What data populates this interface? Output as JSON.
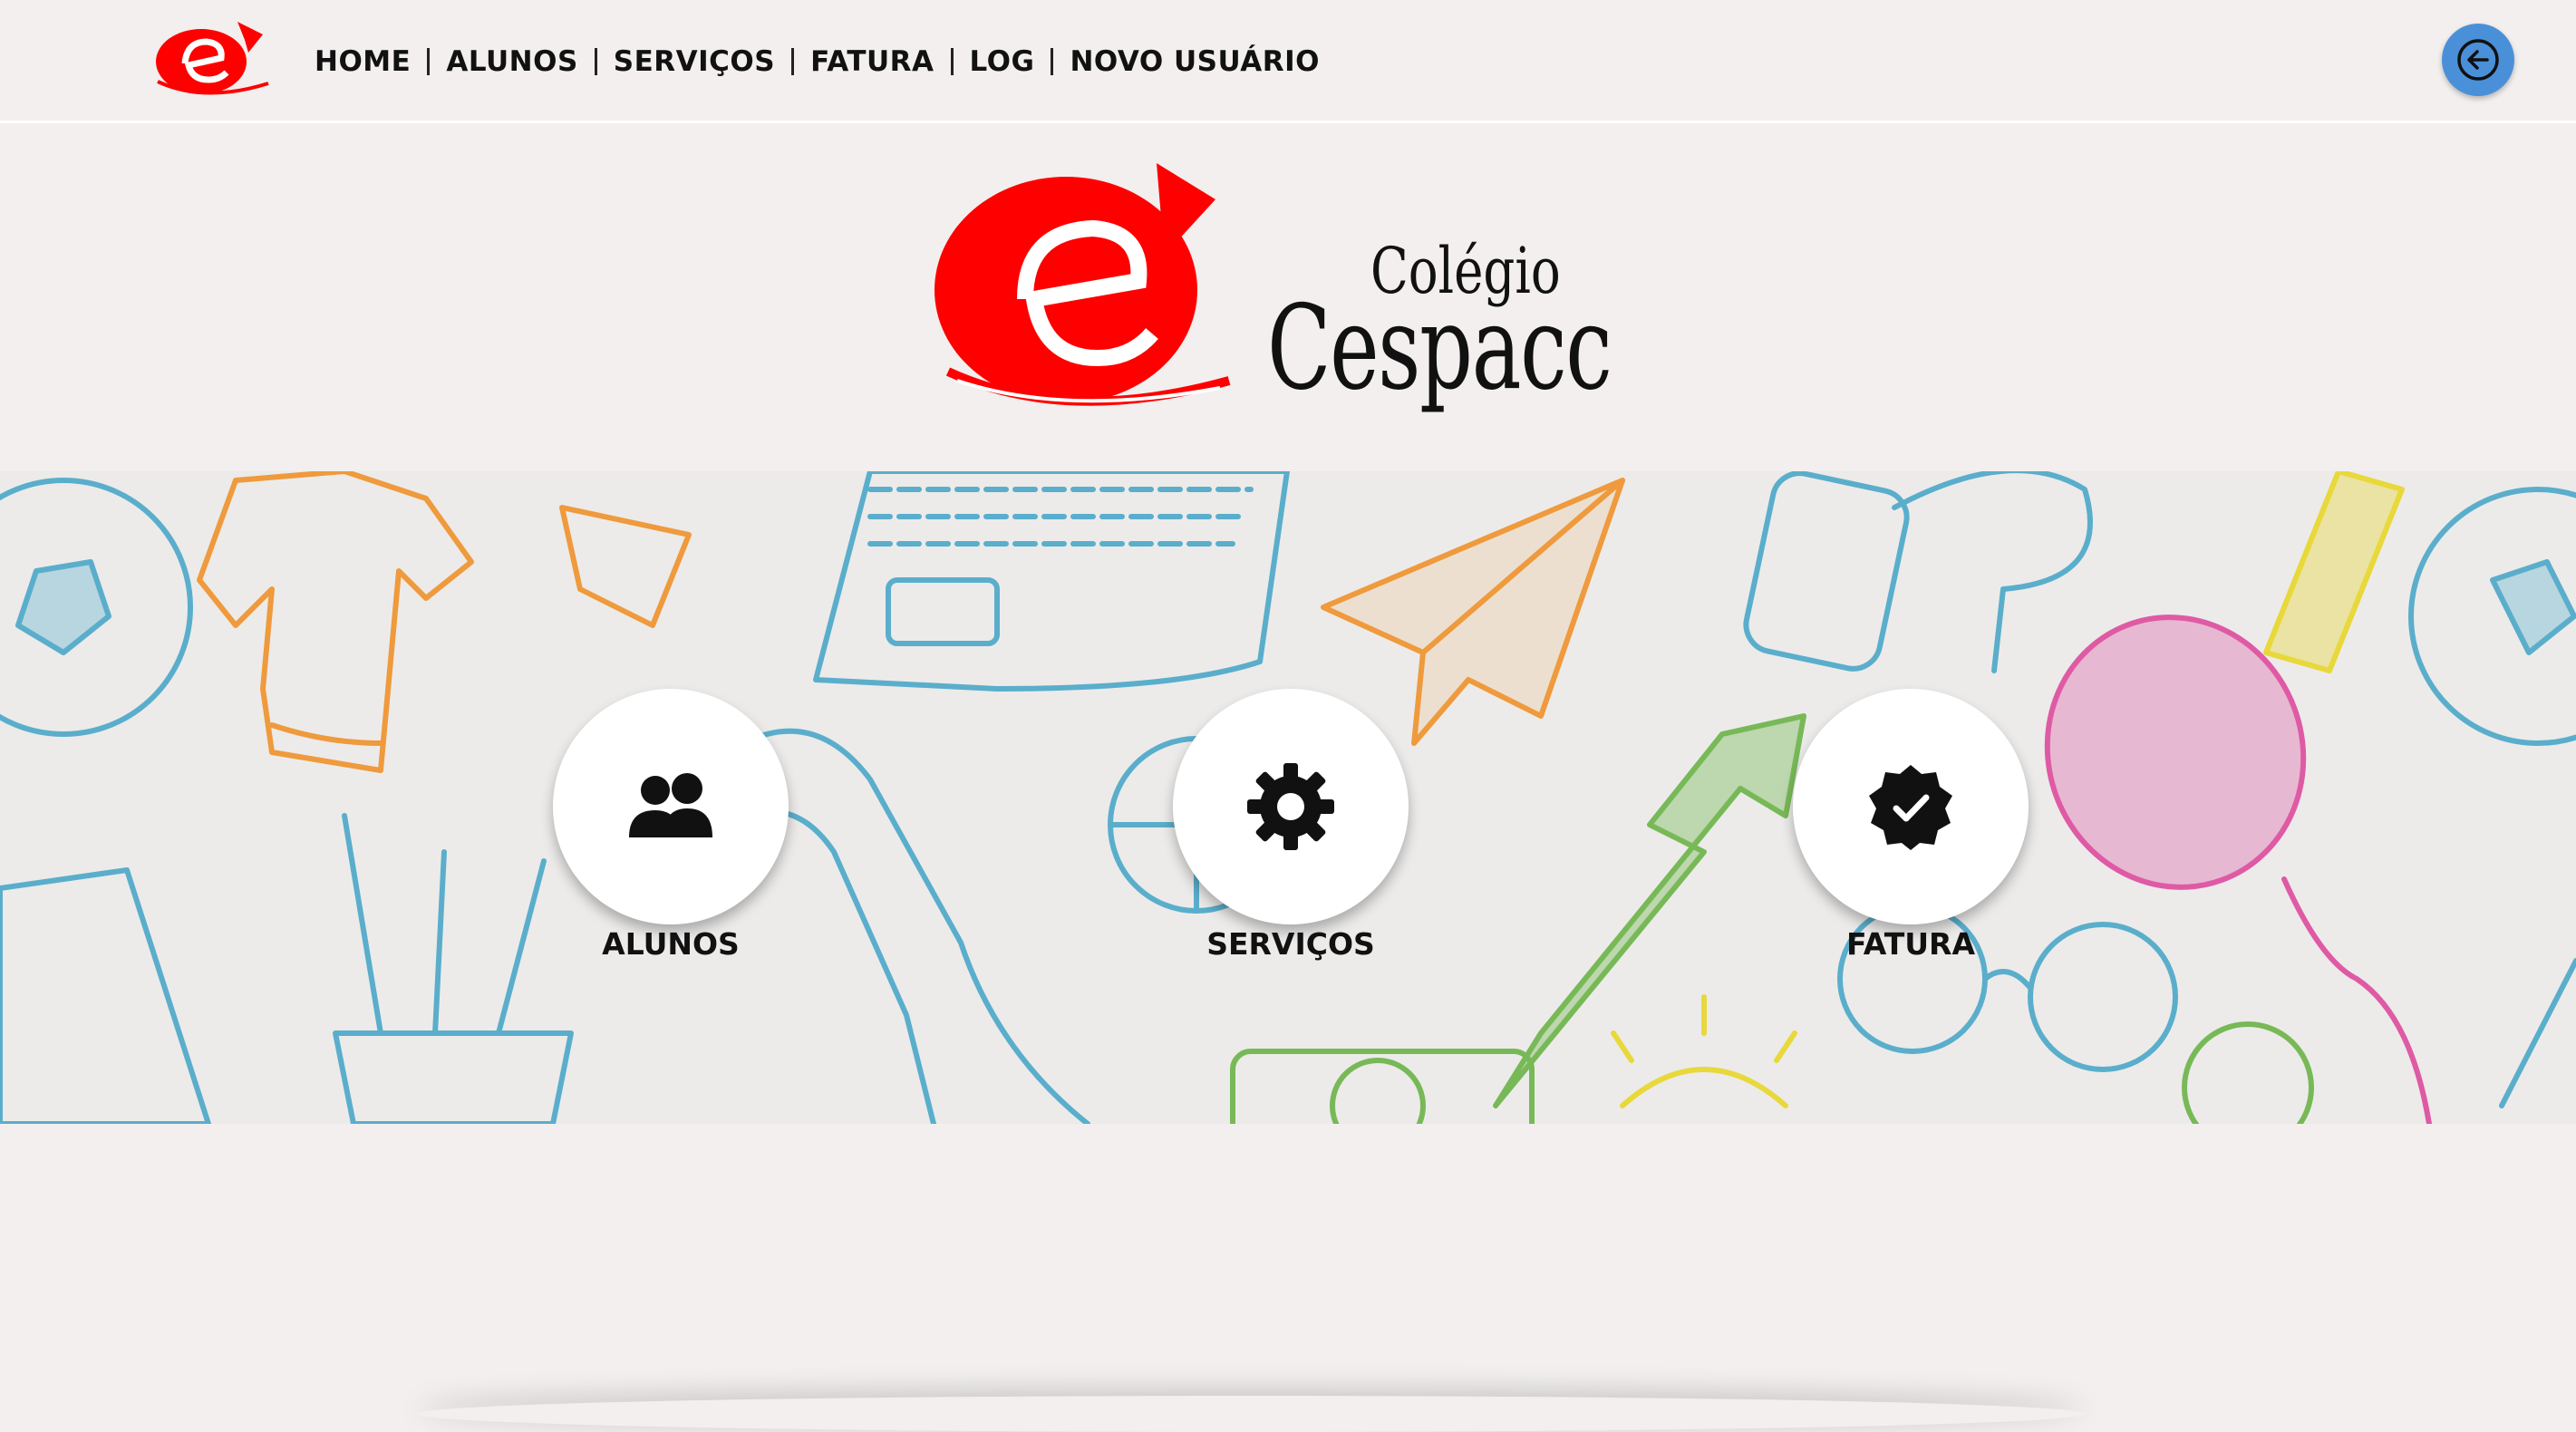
{
  "nav": {
    "items": [
      {
        "label": "HOME"
      },
      {
        "label": "ALUNOS"
      },
      {
        "label": "SERVIÇOS"
      },
      {
        "label": "FATURA"
      },
      {
        "label": "LOG"
      },
      {
        "label": "NOVO USUÁRIO"
      }
    ],
    "back_icon": "arrow-left-circle-icon"
  },
  "hero": {
    "brand_line1": "Colégio",
    "brand_line2": "Cespacc",
    "logo_color": "#ff0000"
  },
  "cards": [
    {
      "label": "ALUNOS",
      "icon": "users-icon"
    },
    {
      "label": "SERVIÇOS",
      "icon": "gear-icon"
    },
    {
      "label": "FATURA",
      "icon": "verified-badge-icon"
    }
  ],
  "colors": {
    "background": "#f2efee",
    "accent_blue": "#4a90d9",
    "logo_red": "#ff0000"
  }
}
